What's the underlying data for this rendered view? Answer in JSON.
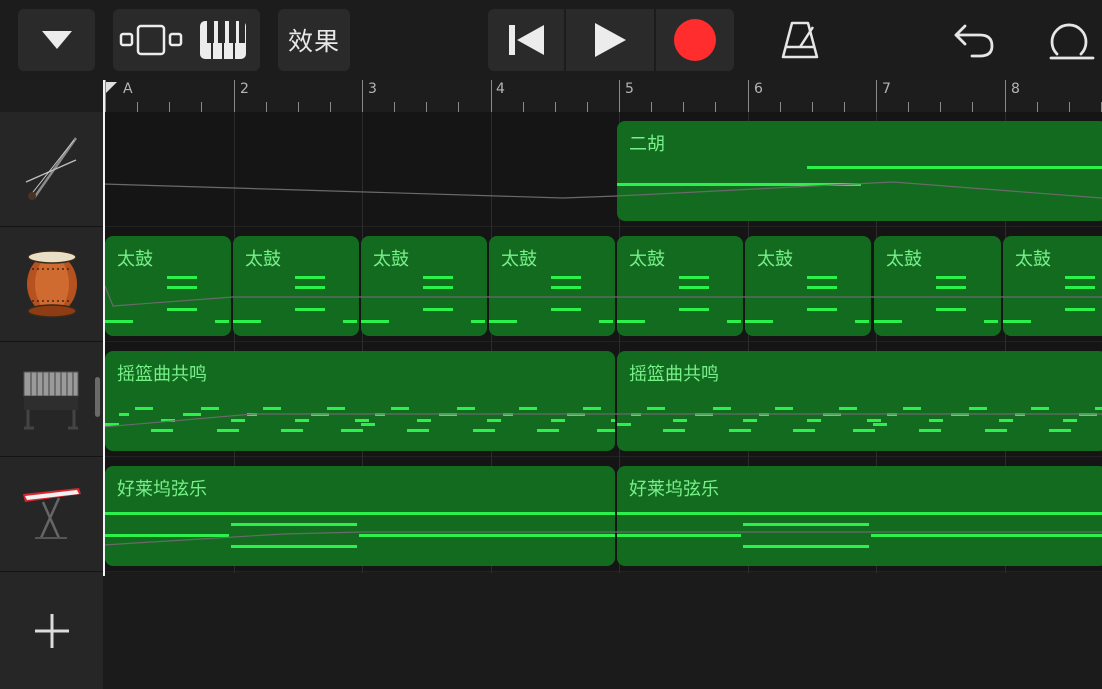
{
  "toolbar": {
    "fx_label": "效果",
    "icons": [
      "triangle-down-icon",
      "view-toggle-icon",
      "piano-keyboard-icon",
      "skip-back-icon",
      "play-icon",
      "record-icon",
      "metronome-icon",
      "undo-icon",
      "loop-settings-icon"
    ],
    "record_color": "#ff2d2d"
  },
  "ruler": {
    "bars": [
      "A",
      "2",
      "3",
      "4",
      "5",
      "6",
      "7",
      "8"
    ]
  },
  "tracks": [
    {
      "instrument": "erhu",
      "icon": "erhu-icon",
      "regions": [
        {
          "name": "二胡"
        }
      ]
    },
    {
      "instrument": "taiko",
      "icon": "taiko-drum-icon",
      "regions": [
        {
          "name": "太鼓"
        },
        {
          "name": "太鼓"
        },
        {
          "name": "太鼓"
        },
        {
          "name": "太鼓"
        },
        {
          "name": "太鼓"
        },
        {
          "name": "太鼓"
        },
        {
          "name": "太鼓"
        },
        {
          "name": "太鼓"
        }
      ]
    },
    {
      "instrument": "vibraphone",
      "icon": "vibraphone-icon",
      "regions": [
        {
          "name": "摇篮曲共鸣"
        },
        {
          "name": "摇篮曲共鸣"
        }
      ]
    },
    {
      "instrument": "keyboard",
      "icon": "keyboard-icon",
      "regions": [
        {
          "name": "好莱坞弦乐"
        },
        {
          "name": "好莱坞弦乐"
        }
      ]
    }
  ],
  "add_track": {
    "icon": "plus-icon"
  },
  "colors": {
    "region_fill": "#136b20",
    "note": "#2cf04b",
    "region_text": "#78f08a"
  }
}
